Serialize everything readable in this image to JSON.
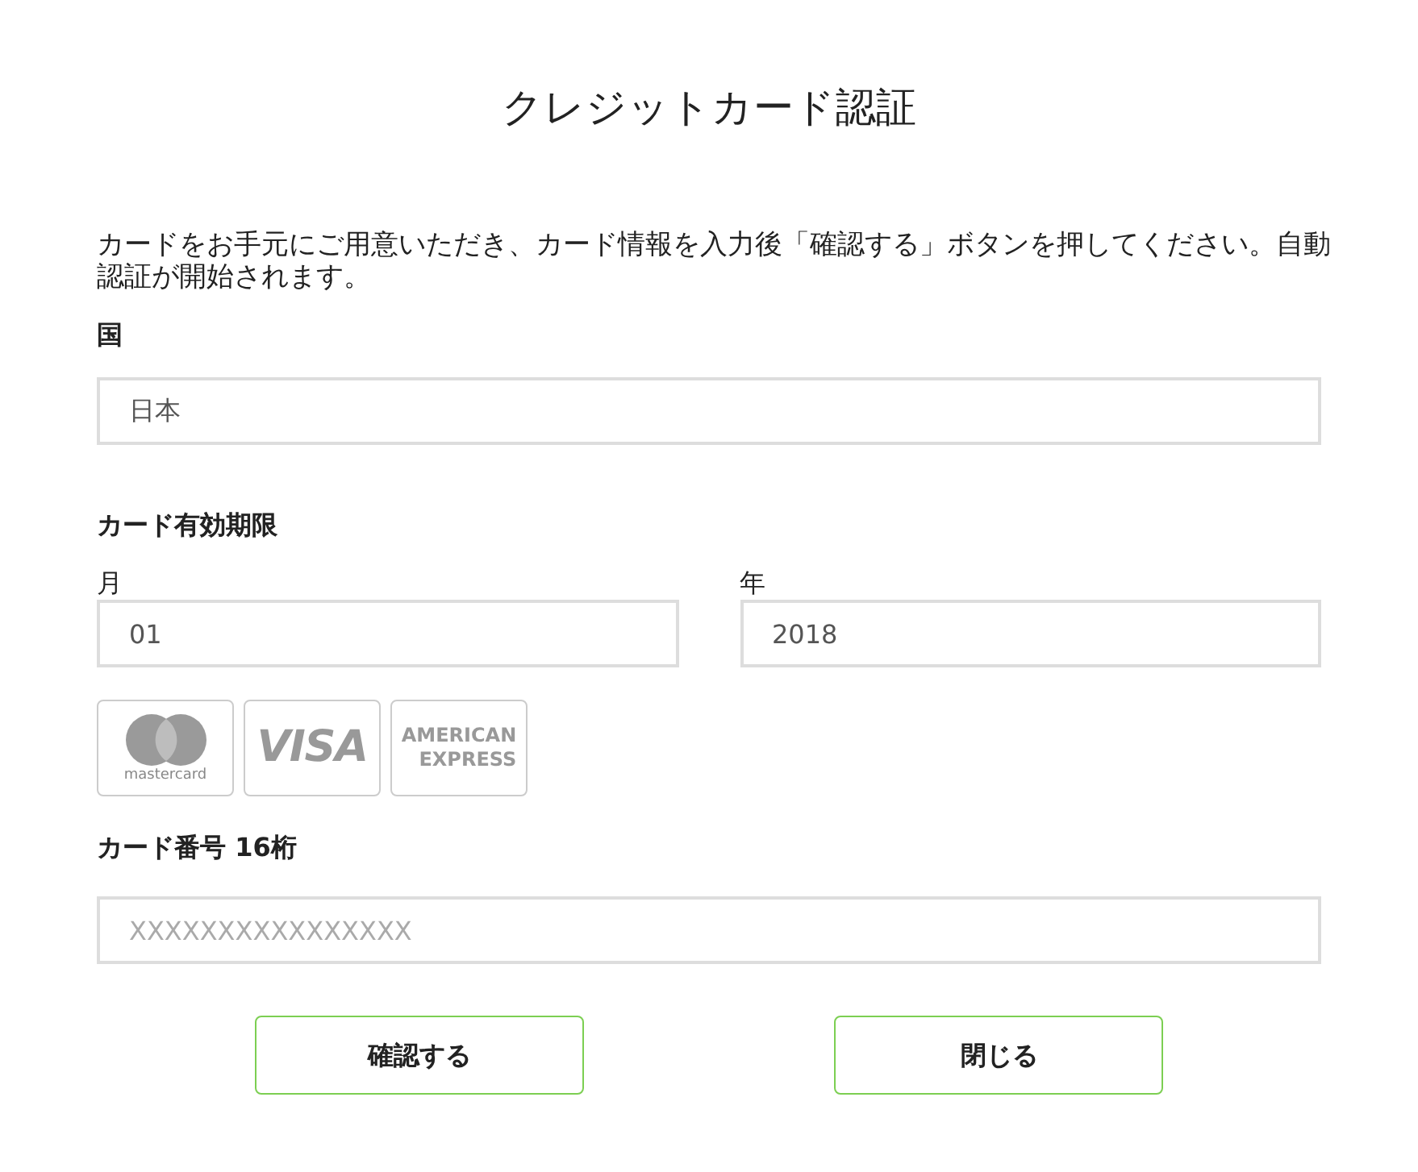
{
  "title": "クレジットカード認証",
  "instructions": "カードをお手元にご用意いただき、カード情報を入力後「確認する」ボタンを押してください。自動認証が開始されます。",
  "country": {
    "label": "国",
    "value": "日本"
  },
  "expiry": {
    "label": "カード有効期限",
    "month": {
      "label": "月",
      "value": "01"
    },
    "year": {
      "label": "年",
      "value": "2018"
    }
  },
  "card_brands": [
    {
      "kind": "circles",
      "lines": [
        "mastercard"
      ]
    },
    {
      "kind": "wordmark",
      "lines": [
        "VISA"
      ]
    },
    {
      "kind": "stacked",
      "lines": [
        "AMERICAN",
        "EXPRESS"
      ]
    }
  ],
  "card_number": {
    "label": "カード番号 16桁",
    "placeholder": "XXXXXXXXXXXXXXXX"
  },
  "buttons": [
    "確認する",
    "閉じる"
  ]
}
